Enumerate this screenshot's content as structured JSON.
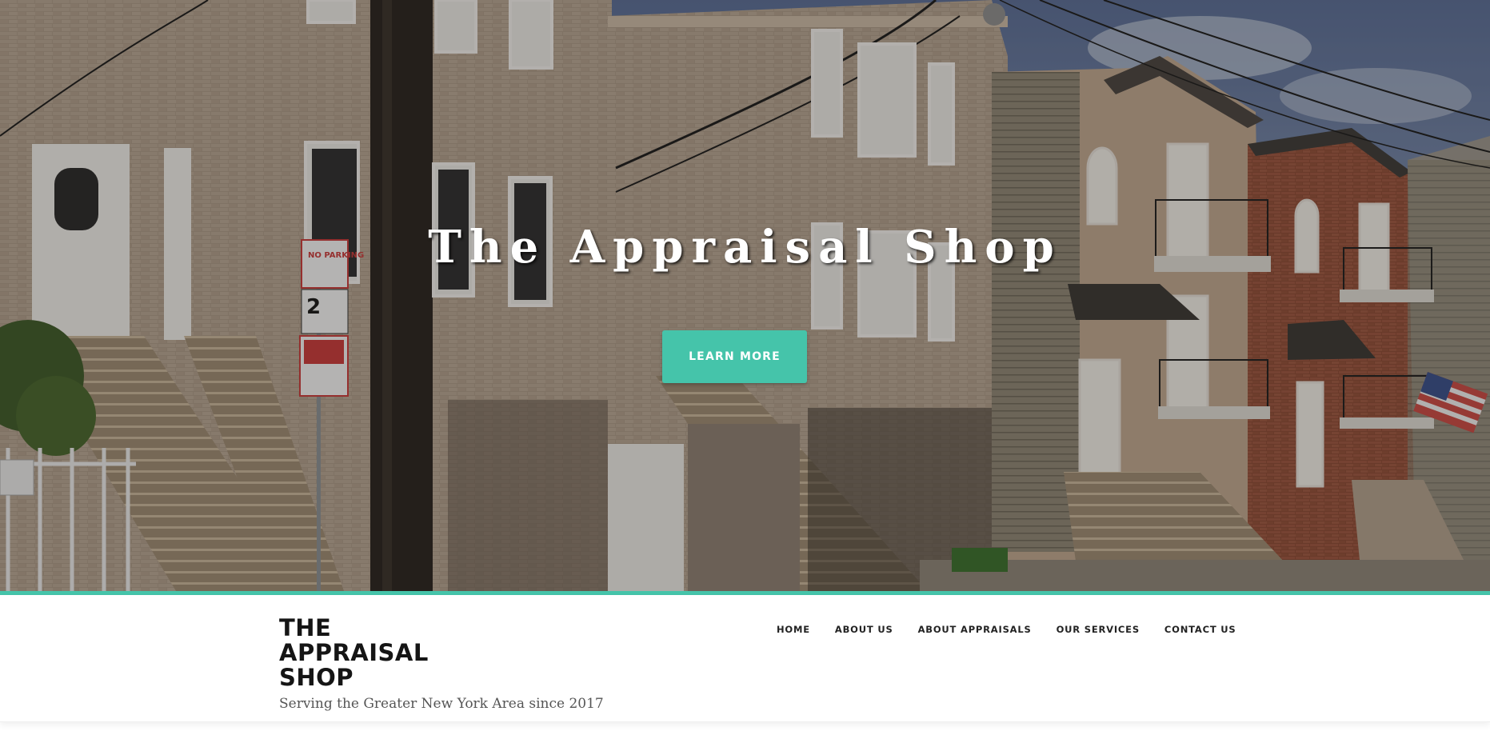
{
  "hero": {
    "title": "The Appraisal Shop",
    "button_label": "LEARN MORE",
    "sign_text": "NO PARKING",
    "sign_number": "2"
  },
  "header": {
    "logo_text": "THE APPRAISAL SHOP",
    "tagline": "Serving the Greater New York Area since 2017",
    "nav": [
      {
        "label": "HOME"
      },
      {
        "label": "ABOUT US"
      },
      {
        "label": "ABOUT APPRAISALS"
      },
      {
        "label": "OUR SERVICES"
      },
      {
        "label": "CONTACT US"
      }
    ]
  },
  "colors": {
    "accent": "#45c4aa",
    "text_dark": "#151515",
    "tagline": "#555555"
  }
}
